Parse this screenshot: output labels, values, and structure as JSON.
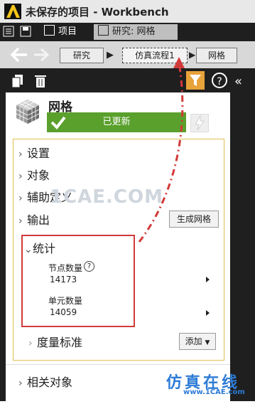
{
  "window": {
    "title": "未保存的项目 - Workbench"
  },
  "tabs": [
    {
      "label": "项目",
      "active": false
    },
    {
      "label": "研究: 网格",
      "active": true
    }
  ],
  "breadcrumb": {
    "items": [
      "研究",
      "仿真流程1",
      "网格"
    ]
  },
  "panel": {
    "title": "网格",
    "status": "已更新",
    "outline": [
      {
        "label": "设置"
      },
      {
        "label": "对象"
      },
      {
        "label": "辅助定义"
      },
      {
        "label": "输出"
      }
    ],
    "generate_mesh_button": "生成网格",
    "stats": {
      "label": "统计",
      "node_count_label": "节点数量",
      "node_count_value": "14173",
      "element_count_label": "单元数量",
      "element_count_value": "14059",
      "help": "?"
    },
    "quality_label": "度量标准",
    "add_button": "添加",
    "related_label": "相关对象"
  },
  "help_button": "?",
  "collapse_button": "«",
  "watermark": "1CAE.COM",
  "brand": {
    "name": "仿真在线",
    "site": "www.1CAE.com"
  },
  "colors": {
    "status_green": "#5aa02c",
    "highlight_red": "#d23a3a",
    "accent_orange": "#e8a23a"
  }
}
